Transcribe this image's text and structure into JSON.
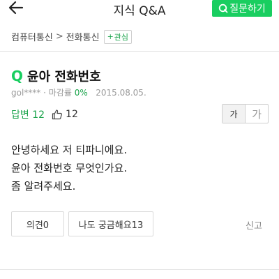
{
  "header": {
    "title": "지식 Q&A",
    "ask_button_label": "질문하기"
  },
  "breadcrumb": {
    "items": [
      "컴퓨터통신",
      "전화통신"
    ],
    "separator": ">",
    "interest_label": "관심"
  },
  "question": {
    "q_mark": "Q",
    "title": "윤아 전화번호",
    "author": "gol****",
    "meta_sep": "·",
    "deadline_label": "마감률",
    "deadline_rate": "0%",
    "date": "2015.08.05.",
    "answer_count_text": "답변 12",
    "like_count": "12",
    "font_small_label": "가",
    "font_large_label": "가",
    "body_lines": [
      "안녕하세요 저 티파니에요.",
      "윤아 전화번호 무엇인가요.",
      "좀 알려주세요."
    ]
  },
  "actions": {
    "opinion_label": "의견0",
    "curious_label": "나도 궁금해요13",
    "report_label": "신고"
  },
  "colors": {
    "accent": "#19ce60",
    "accent_text": "#19a34a"
  }
}
